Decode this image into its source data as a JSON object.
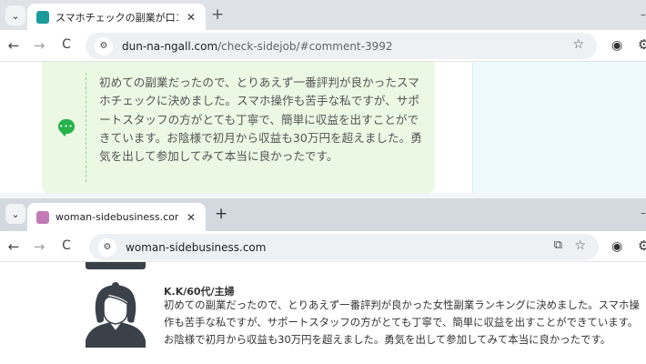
{
  "window1": {
    "tab_title": "スマホチェックの副業が口コミで大絶",
    "url_host": "dun-na-ngall.com",
    "url_path": "/check-sidejob/#comment-3992",
    "comment": "初めての副業だったので、とりあえず一番評判が良かったスマホチェックに決めました。スマホ操作も苦手な私ですが、サポートスタッフの方がとても丁寧で、簡単に収益を出すことができています。お陰様で初月から収益も30万円を超えました。勇気を出して参加してみて本当に良かったです。"
  },
  "window2": {
    "tab_title": "woman-sidebusiness.com",
    "url_host": "woman-sidebusiness.com",
    "review_name": "K.K/60代/主婦",
    "review_text": "初めての副業だったので、とりあえず一番評判が良かった女性副業ランキングに決めました。スマホ操作も苦手な私ですが、サポートスタッフの方がとても丁寧で、簡単に収益を出すことができています。お陰様で初月から収益も30万円を超えました。勇気を出して参加してみて本当に良かったです。"
  },
  "icons": {
    "tab_menu": "chevron-down-icon",
    "close": "close-icon",
    "new_tab": "plus-icon",
    "back": "arrow-left-icon",
    "forward": "arrow-right-icon",
    "reload": "reload-icon",
    "site_info": "tune-icon",
    "bookmark": "star-icon",
    "comment": "chat-bubble-icon",
    "avatar": "user-avatar-icon"
  },
  "colors": {
    "comment_bg": "#eaf8e4",
    "chat_icon": "#27b14a",
    "sidebar_bg": "#edfbff"
  }
}
